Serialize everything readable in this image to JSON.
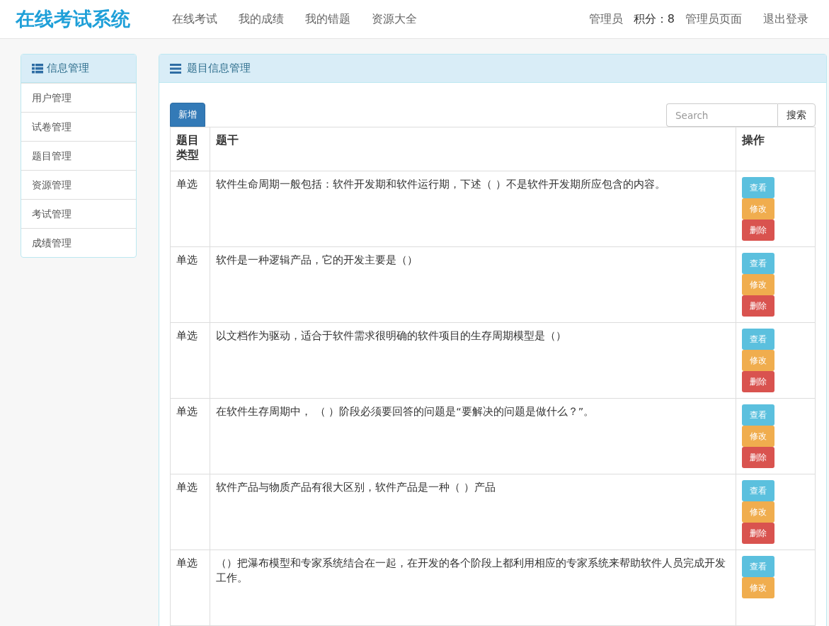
{
  "header": {
    "logo": "在线考试系统",
    "nav": [
      {
        "label": "在线考试"
      },
      {
        "label": "我的成绩"
      },
      {
        "label": "我的错题"
      },
      {
        "label": "资源大全"
      }
    ],
    "user": [
      {
        "label": "管理员"
      },
      {
        "label": "积分：8"
      },
      {
        "label": "管理员页面"
      },
      {
        "label": "退出登录"
      }
    ]
  },
  "sidebar": {
    "title": "信息管理",
    "items": [
      {
        "label": "用户管理"
      },
      {
        "label": "试卷管理"
      },
      {
        "label": "题目管理"
      },
      {
        "label": "资源管理"
      },
      {
        "label": "考试管理"
      },
      {
        "label": "成绩管理"
      }
    ]
  },
  "panel": {
    "title": "题目信息管理",
    "add_button": "新增",
    "search": {
      "placeholder": "Search",
      "button": "搜索"
    },
    "table": {
      "columns": [
        "题目类型",
        "题干",
        "操作"
      ],
      "rows": [
        {
          "type": "单选",
          "stem": "软件生命周期一般包括：软件开发期和软件运行期，下述（ ）不是软件开发期所应包含的内容。",
          "actions": [
            {
              "kind": "view",
              "label": "查看"
            },
            {
              "kind": "edit",
              "label": "修改"
            },
            {
              "kind": "delete",
              "label": "删除"
            }
          ]
        },
        {
          "type": "单选",
          "stem": "软件是一种逻辑产品，它的开发主要是（）",
          "actions": [
            {
              "kind": "view",
              "label": "查看"
            },
            {
              "kind": "edit",
              "label": "修改"
            },
            {
              "kind": "delete",
              "label": "删除"
            }
          ]
        },
        {
          "type": "单选",
          "stem": "以文档作为驱动，适合于软件需求很明确的软件项目的生存周期模型是（）",
          "actions": [
            {
              "kind": "view",
              "label": "查看"
            },
            {
              "kind": "edit",
              "label": "修改"
            },
            {
              "kind": "delete",
              "label": "删除"
            }
          ]
        },
        {
          "type": "单选",
          "stem": "在软件生存周期中，  （ ）阶段必须要回答的问题是“要解决的问题是做什么？”。",
          "actions": [
            {
              "kind": "view",
              "label": "查看"
            },
            {
              "kind": "edit",
              "label": "修改"
            },
            {
              "kind": "delete",
              "label": "删除"
            }
          ]
        },
        {
          "type": "单选",
          "stem": "软件产品与物质产品有很大区别，软件产品是一种（ ）产品",
          "actions": [
            {
              "kind": "view",
              "label": "查看"
            },
            {
              "kind": "edit",
              "label": "修改"
            },
            {
              "kind": "delete",
              "label": "删除"
            }
          ]
        },
        {
          "type": "单选",
          "stem": "（）把瀑布模型和专家系统结合在一起，在开发的各个阶段上都利用相应的专家系统来帮助软件人员完成开发工作。",
          "actions": [
            {
              "kind": "view",
              "label": "查看"
            },
            {
              "kind": "edit",
              "label": "修改"
            }
          ]
        }
      ]
    }
  }
}
